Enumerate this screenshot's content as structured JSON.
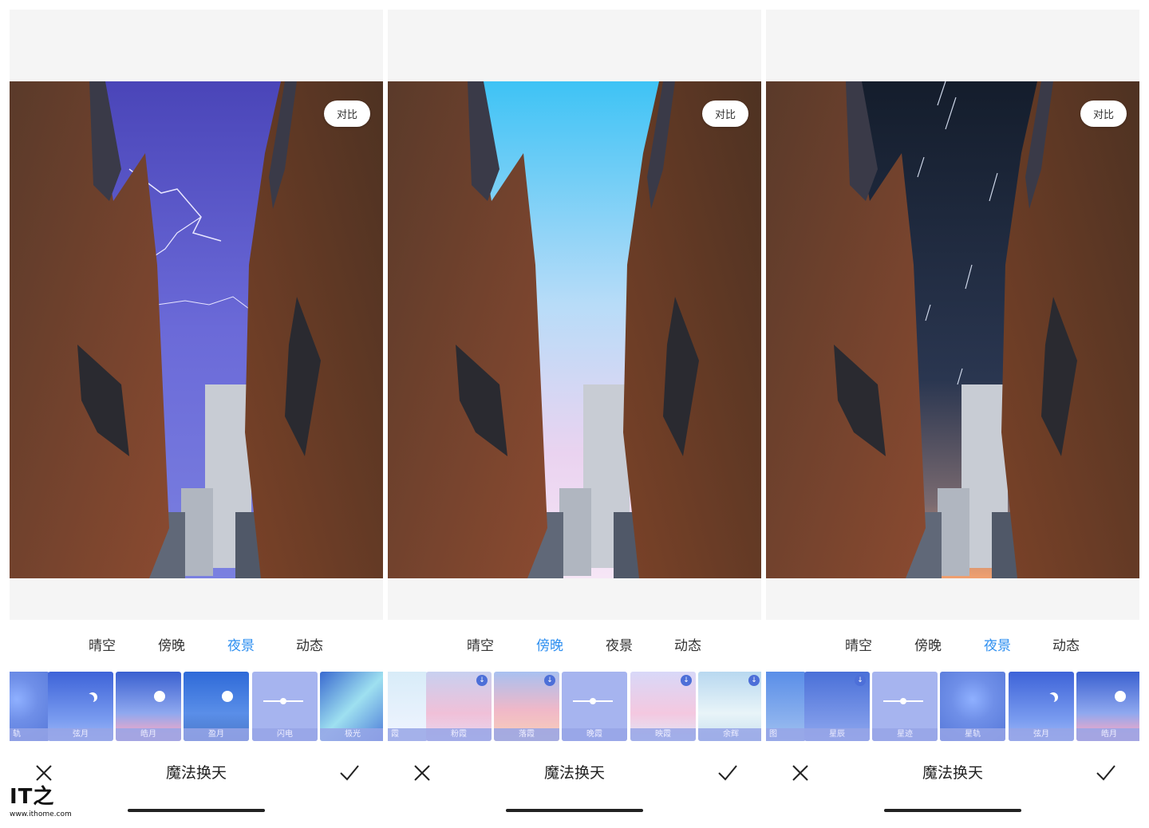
{
  "compare_label": "对比",
  "app_title": "魔法换天",
  "watermark": {
    "brand": "IT之家",
    "mark": "IT之",
    "url": "www.ithome.com"
  },
  "icons": {
    "close": "close-icon",
    "confirm": "check-icon",
    "download": "download-icon"
  },
  "accent_color": "#2e8ff0",
  "panels": [
    {
      "sky": "lightning",
      "tabs": [
        "晴空",
        "傍晚",
        "夜景",
        "动态"
      ],
      "active_tab": "夜景",
      "thumbs": [
        {
          "label": "轨",
          "style": "trail",
          "download": false
        },
        {
          "label": "弦月",
          "style": "crescent",
          "download": false
        },
        {
          "label": "皓月",
          "style": "moon-pink",
          "download": false
        },
        {
          "label": "盈月",
          "style": "moon-blue",
          "download": false
        },
        {
          "label": "闪电",
          "style": "slider",
          "download": false
        },
        {
          "label": "极光",
          "style": "aurora",
          "download": false
        }
      ]
    },
    {
      "sky": "dusk",
      "tabs": [
        "晴空",
        "傍晚",
        "夜景",
        "动态"
      ],
      "active_tab": "傍晚",
      "thumbs": [
        {
          "label": "霞",
          "style": "pale",
          "download": false
        },
        {
          "label": "粉霞",
          "style": "pink",
          "download": true
        },
        {
          "label": "落霞",
          "style": "peach",
          "download": true
        },
        {
          "label": "晚霞",
          "style": "slider",
          "download": false
        },
        {
          "label": "映霞",
          "style": "pinkblue",
          "download": true
        },
        {
          "label": "余辉",
          "style": "cloud",
          "download": true
        }
      ]
    },
    {
      "sky": "startrail",
      "tabs": [
        "晴空",
        "傍晚",
        "夜景",
        "动态"
      ],
      "active_tab": "夜景",
      "thumbs": [
        {
          "label": "图",
          "style": "blue",
          "download": false
        },
        {
          "label": "星辰",
          "style": "stars",
          "download": true
        },
        {
          "label": "星迹",
          "style": "slider",
          "download": false
        },
        {
          "label": "星轨",
          "style": "trail",
          "download": false
        },
        {
          "label": "弦月",
          "style": "crescent",
          "download": false
        },
        {
          "label": "皓月",
          "style": "moon-pink",
          "download": false
        }
      ]
    }
  ]
}
